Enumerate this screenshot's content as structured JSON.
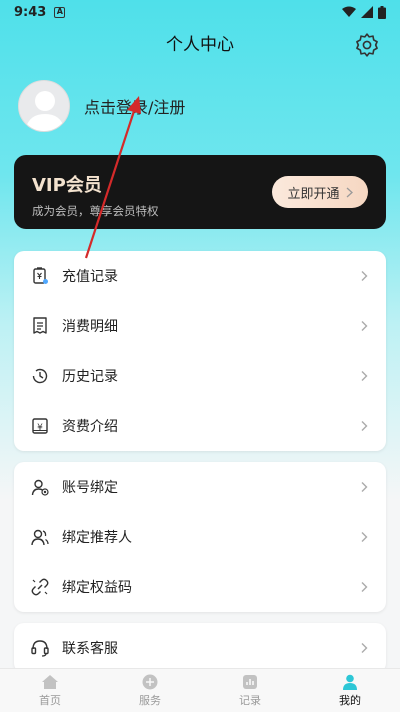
{
  "status_bar": {
    "time": "9:43",
    "notif_glyph": "A"
  },
  "header": {
    "title": "个人中心"
  },
  "profile": {
    "login_text": "点击登录/注册"
  },
  "vip": {
    "title": "VIP会员",
    "subtitle": "成为会员，尊享会员特权",
    "button": "立即开通"
  },
  "menu_group_1": [
    {
      "label": "充值记录",
      "icon": "recharge-icon"
    },
    {
      "label": "消费明细",
      "icon": "receipt-icon"
    },
    {
      "label": "历史记录",
      "icon": "history-icon"
    },
    {
      "label": "资费介绍",
      "icon": "price-icon"
    }
  ],
  "menu_group_2": [
    {
      "label": "账号绑定",
      "icon": "account-bind-icon"
    },
    {
      "label": "绑定推荐人",
      "icon": "referrer-icon"
    },
    {
      "label": "绑定权益码",
      "icon": "link-code-icon"
    }
  ],
  "menu_group_3": [
    {
      "label": "联系客服",
      "icon": "headset-icon"
    }
  ],
  "tabs": [
    {
      "label": "首页",
      "icon": "home-icon",
      "active": false
    },
    {
      "label": "服务",
      "icon": "service-icon",
      "active": false
    },
    {
      "label": "记录",
      "icon": "record-icon",
      "active": false
    },
    {
      "label": "我的",
      "icon": "profile-icon",
      "active": true
    }
  ],
  "colors": {
    "accent": "#4fe0ea",
    "vip_bg": "#151515",
    "vip_title": "#f4e3cf",
    "annotation_arrow": "#d42a2a"
  }
}
